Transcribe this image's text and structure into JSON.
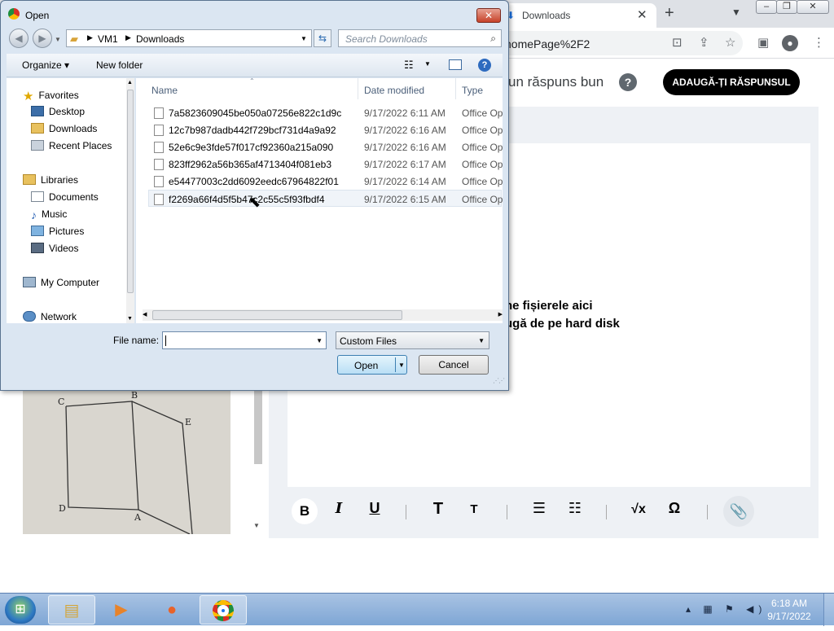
{
  "browser": {
    "tab_title": "Downloads",
    "tab_close": "✕",
    "new_tab": "+",
    "tab_menu": "⌄",
    "window_controls": [
      "–",
      "❐",
      "✕"
    ],
    "address_fragment": "homePage%2F2",
    "icons": [
      "translate-icon",
      "share-icon",
      "star-icon",
      "sidepanel-icon",
      "profile-icon",
      "menu-icon"
    ]
  },
  "page": {
    "question_fragment": "un răspuns bun",
    "help_glyph": "?",
    "add_answer_button": "ADAUGĂ-ȚI RĂSPUNSUL",
    "drop_line1": "ne fișierele aici",
    "drop_line2": "ugă de pe hard disk",
    "photo_labels": {
      "c": "C",
      "b": "B",
      "e": "E",
      "d": "D",
      "a": "A"
    },
    "editor_tools": [
      "B",
      "I",
      "U",
      "T",
      "T",
      "☰",
      "☷",
      "√x",
      "Ω"
    ]
  },
  "dialog": {
    "title": "Open",
    "close": "✕",
    "path": [
      "VM1",
      "Downloads"
    ],
    "search_placeholder": "Search Downloads",
    "organize": "Organize ▾",
    "new_folder": "New folder",
    "nav": {
      "favorites": "Favorites",
      "desktop": "Desktop",
      "downloads": "Downloads",
      "recent_places": "Recent Places",
      "libraries": "Libraries",
      "documents": "Documents",
      "music": "Music",
      "pictures": "Pictures",
      "videos": "Videos",
      "my_computer": "My Computer",
      "network": "Network"
    },
    "columns": {
      "name": "Name",
      "date": "Date modified",
      "type": "Type"
    },
    "files": [
      {
        "name": "7a5823609045be050a07256e822c1d9c",
        "date": "9/17/2022 6:11 AM",
        "type": "Office Open"
      },
      {
        "name": "12c7b987dadb442f729bcf731d4a9a92",
        "date": "9/17/2022 6:16 AM",
        "type": "Office Open"
      },
      {
        "name": "52e6c9e3fde57f017cf92360a215a090",
        "date": "9/17/2022 6:16 AM",
        "type": "Office Open"
      },
      {
        "name": "823ff2962a56b365af4713404f081eb3",
        "date": "9/17/2022 6:17 AM",
        "type": "Office Open"
      },
      {
        "name": "e54477003c2dd6092eedc67964822f01",
        "date": "9/17/2022 6:14 AM",
        "type": "Office Open"
      },
      {
        "name": "f2269a66f4d5f5b47c2c55c5f93fbdf4",
        "date": "9/17/2022 6:15 AM",
        "type": "Office Open"
      }
    ],
    "file_name_label": "File name:",
    "file_name_value": "",
    "file_type": "Custom Files",
    "open_button": "Open",
    "cancel_button": "Cancel"
  },
  "taskbar": {
    "time": "6:18 AM",
    "date": "9/17/2022"
  }
}
